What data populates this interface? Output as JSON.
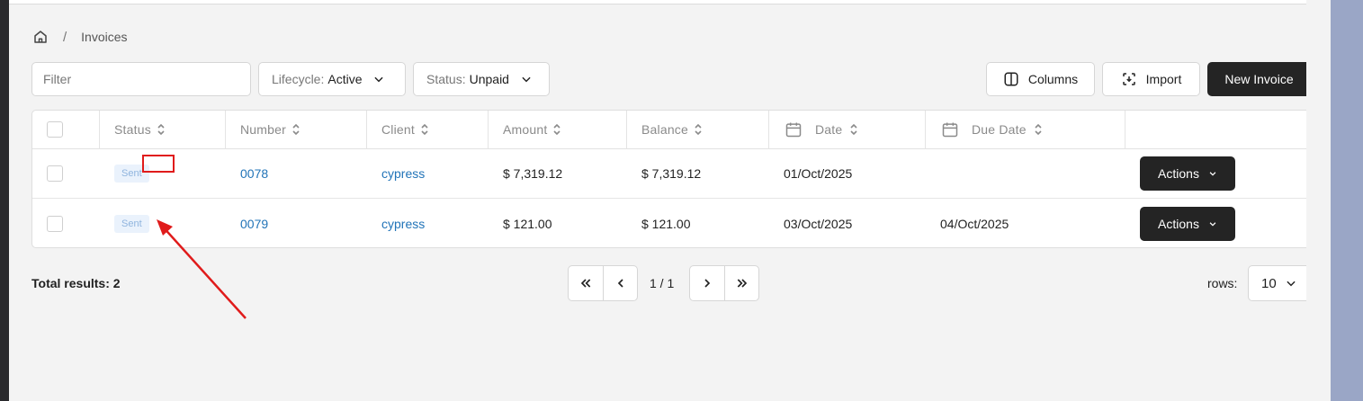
{
  "breadcrumb": {
    "home_icon": "home-icon",
    "separator": "/",
    "current": "Invoices"
  },
  "filters": {
    "filter_placeholder": "Filter",
    "lifecycle": {
      "label": "Lifecycle:",
      "value": "Active"
    },
    "status": {
      "label": "Status:",
      "value": "Unpaid"
    }
  },
  "toolbar": {
    "columns_label": "Columns",
    "import_label": "Import",
    "new_invoice_label": "New Invoice"
  },
  "table": {
    "headers": [
      "Status",
      "Number",
      "Client",
      "Amount",
      "Balance",
      "Date",
      "Due Date"
    ],
    "rows": [
      {
        "status": "Sent",
        "number": "0078",
        "client": "cypress",
        "amount": "$ 7,319.12",
        "balance": "$ 7,319.12",
        "date": "01/Oct/2025",
        "due_date": "",
        "action": "Actions"
      },
      {
        "status": "Sent",
        "number": "0079",
        "client": "cypress",
        "amount": "$ 121.00",
        "balance": "$ 121.00",
        "date": "03/Oct/2025",
        "due_date": "04/Oct/2025",
        "action": "Actions"
      }
    ]
  },
  "footer": {
    "total_results": "Total results: 2",
    "page_indicator": "1 / 1",
    "rows_label": "rows:",
    "rows_value": "10"
  },
  "colors": {
    "link": "#2274b8",
    "dark_button": "#242424",
    "badge_text": "#8fb4de",
    "badge_bg": "#eaf2fc",
    "annotation": "#e01b1b"
  }
}
